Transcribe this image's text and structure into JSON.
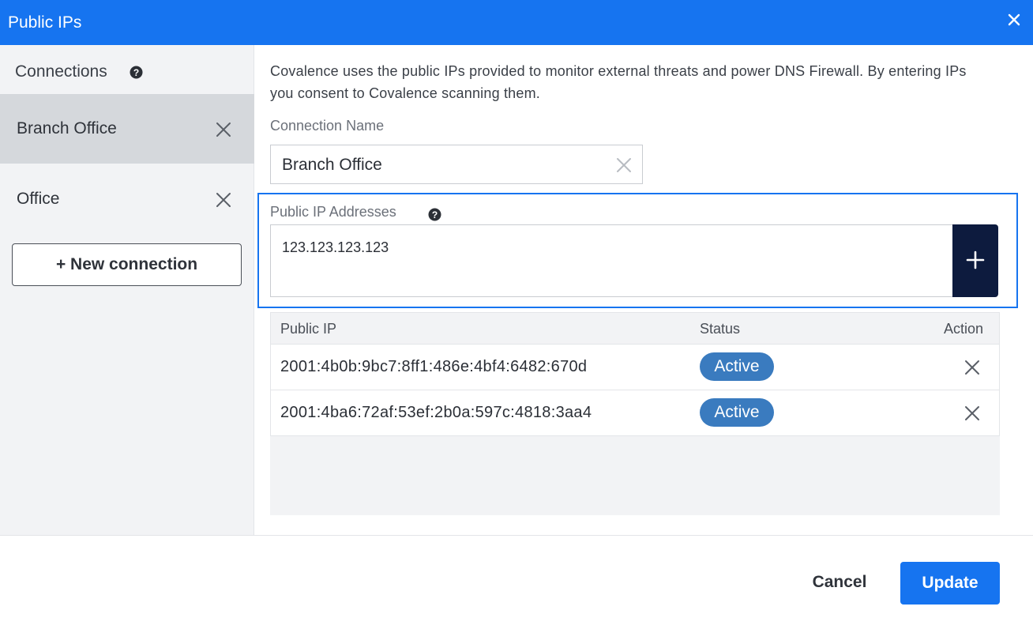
{
  "dialog": {
    "title": "Public IPs",
    "close_icon": "close-icon"
  },
  "sidebar": {
    "heading": "Connections",
    "help_icon": "help-circle-icon",
    "items": [
      {
        "label": "Branch Office",
        "selected": true
      },
      {
        "label": "Office",
        "selected": false
      }
    ],
    "new_connection_label": "+ New connection"
  },
  "main": {
    "description": "Covalence uses the public IPs provided to monitor external threats and power DNS Firewall. By entering IPs you consent to Covalence scanning them.",
    "connection_name_label": "Connection Name",
    "connection_name_value": "Branch Office",
    "public_ip_label": "Public IP Addresses",
    "public_ip_input_value": "123.123.123.123",
    "add_icon": "plus-icon"
  },
  "table": {
    "columns": [
      "Public IP",
      "Status",
      "Action"
    ],
    "rows": [
      {
        "ip": "2001:4b0b:9bc7:8ff1:486e:4bf4:6482:670d",
        "status": "Active"
      },
      {
        "ip": "2001:4ba6:72af:53ef:2b0a:597c:4818:3aa4",
        "status": "Active"
      }
    ]
  },
  "footer": {
    "cancel_label": "Cancel",
    "update_label": "Update"
  },
  "colors": {
    "accent": "#1674f0",
    "badge": "#3a7bbf",
    "add_button": "#0d1b3e"
  }
}
